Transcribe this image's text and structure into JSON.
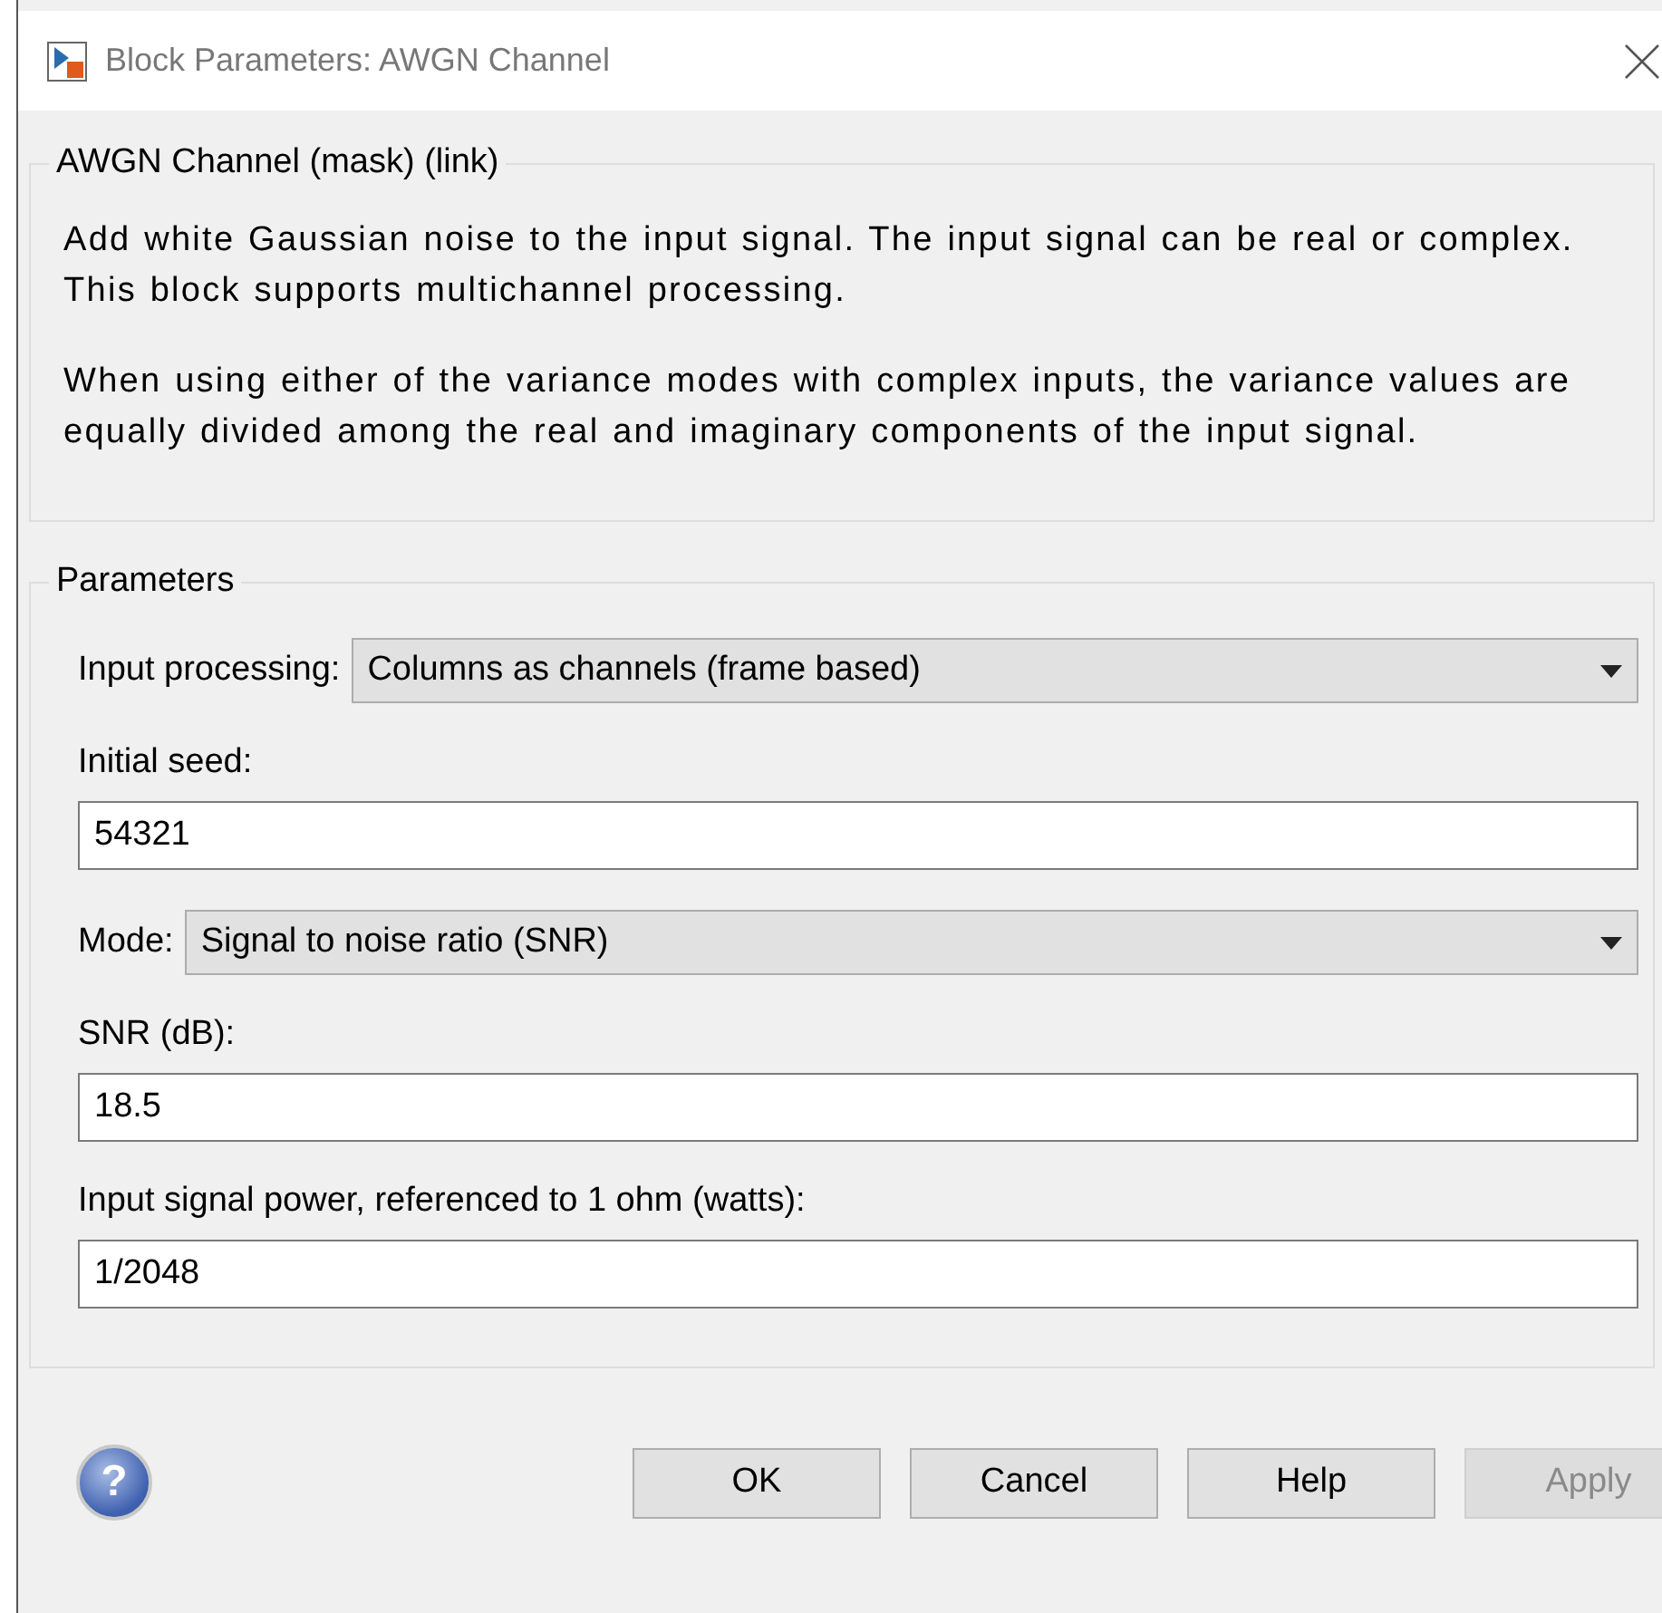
{
  "window": {
    "title": "Block Parameters: AWGN Channel"
  },
  "description": {
    "legend": "AWGN Channel (mask) (link)",
    "paragraphs": [
      "Add white Gaussian noise to the input signal. The input signal can be real or complex. This block supports multichannel processing.",
      "When using either of the variance modes with complex inputs, the variance values are equally divided among the real and imaginary components of the input signal."
    ]
  },
  "parameters": {
    "legend": "Parameters",
    "fields": [
      {
        "kind": "dropdown",
        "label": "Input processing:",
        "value": "Columns as channels (frame based)"
      },
      {
        "kind": "text",
        "label": "Initial seed:",
        "value": "54321"
      },
      {
        "kind": "dropdown",
        "label": "Mode:",
        "value": "Signal to noise ratio  (SNR)"
      },
      {
        "kind": "text",
        "label": "SNR (dB):",
        "value": "18.5"
      },
      {
        "kind": "text",
        "label": "Input signal power, referenced to 1 ohm (watts):",
        "value": "1/2048"
      }
    ]
  },
  "help_icon": "?",
  "buttons": [
    {
      "label": "OK",
      "disabled": false
    },
    {
      "label": "Cancel",
      "disabled": false
    },
    {
      "label": "Help",
      "disabled": false
    },
    {
      "label": "Apply",
      "disabled": true
    }
  ]
}
